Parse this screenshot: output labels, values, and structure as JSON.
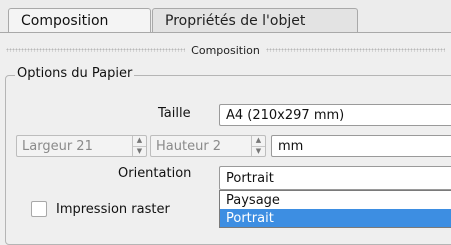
{
  "tabs": [
    {
      "label": "Composition"
    },
    {
      "label": "Propriétés de l'objet"
    }
  ],
  "section_title": "Composition",
  "group_title": "Options du Papier",
  "size": {
    "label": "Taille",
    "value": "A4 (210x297 mm)"
  },
  "width": {
    "value": "Largeur 21"
  },
  "height": {
    "value": "Hauteur 2"
  },
  "unit": {
    "value": "mm"
  },
  "orientation": {
    "label": "Orientation",
    "value": "Portrait",
    "options": [
      "Paysage",
      "Portrait"
    ]
  },
  "raster": {
    "label": "Impression raster"
  },
  "icons": {
    "spin_up": "▲",
    "spin_down": "▼"
  }
}
